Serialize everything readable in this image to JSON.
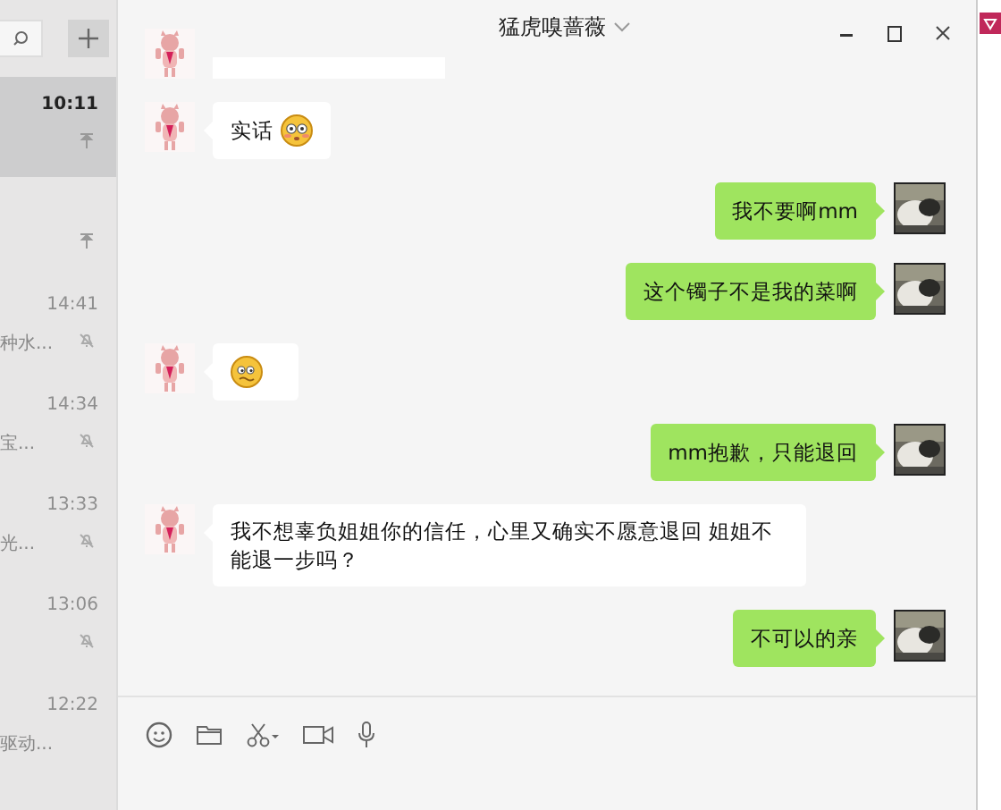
{
  "window": {
    "title": "猛虎嗅蔷薇"
  },
  "sidebar": {
    "items": [
      {
        "time": "10:11",
        "kind": "pinned",
        "selected": true
      },
      {
        "kind": "pinned",
        "selected": false
      },
      {
        "time": "14:41",
        "preview": "种水...",
        "kind": "muted",
        "selected": false
      },
      {
        "time": "14:34",
        "preview": "宝...",
        "kind": "muted",
        "selected": false
      },
      {
        "time": "13:33",
        "preview": "光...",
        "kind": "muted",
        "selected": false
      },
      {
        "time": "13:06",
        "kind": "muted",
        "selected": false
      },
      {
        "time": "12:22",
        "preview": "驱动...",
        "kind": "plain",
        "selected": false
      }
    ]
  },
  "messages": [
    {
      "kind": "partial"
    },
    {
      "kind": "reaction",
      "text": "实话"
    },
    {
      "kind": "outgoing",
      "text": "我不要啊mm"
    },
    {
      "kind": "outgoing",
      "text": "这个镯子不是我的菜啊"
    },
    {
      "kind": "sticker"
    },
    {
      "kind": "outgoing",
      "text": "mm抱歉，只能退回"
    },
    {
      "kind": "incoming",
      "text": "我不想辜负姐姐你的信任，心里又确实不愿意退回  姐姐不能退一步吗？"
    },
    {
      "kind": "outgoing",
      "text": "不可以的亲"
    }
  ]
}
